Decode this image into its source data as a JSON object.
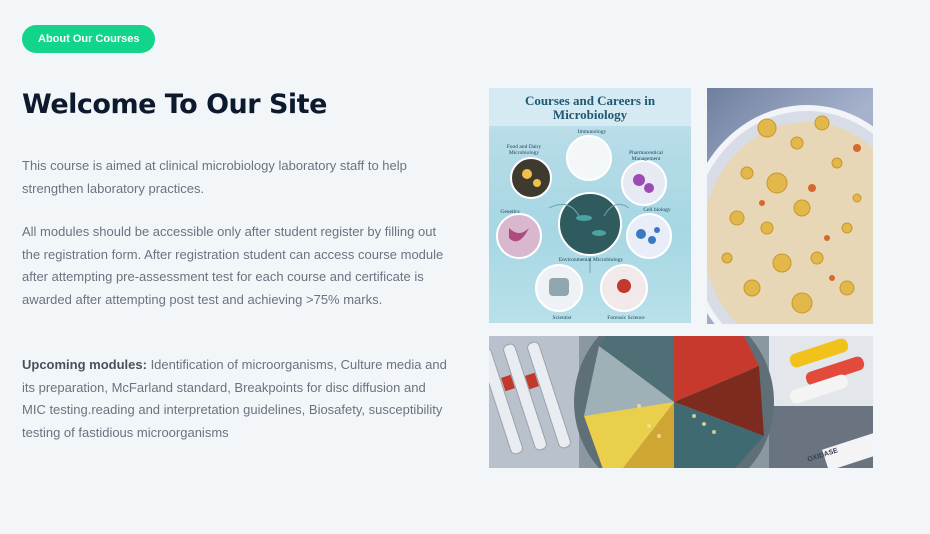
{
  "badge": {
    "label": "About Our Courses"
  },
  "page": {
    "title": "Welcome To Our Site"
  },
  "paragraphs": {
    "p1": "This course is aimed at clinical microbiology laboratory staff to help strengthen laboratory practices.",
    "p2": "All modules should be accessible only after student register by filling out the registration form. After registration student can access course module after attempting pre-assessment test for each course and certificate is awarded after attempting post test and achieving >75% marks.",
    "p3_label": "Upcoming modules:",
    "p3_text": " Identification of microorganisms, Culture media and its preparation, McFarland standard, Breakpoints for disc diffusion and MIC testing.reading and interpretation guidelines, Biosafety, susceptibility testing of fastidious microorganisms"
  },
  "images": {
    "poster": {
      "title_line1": "Courses and Careers in",
      "title_line2": "Microbiology",
      "captions": {
        "immunology": "Immunology",
        "food": "Food and Dairy Microbiology",
        "pharma": "Pharmaceutical Management",
        "genetics": "Genetics",
        "cell": "Cell biology",
        "environmental": "Environmental Microbiology",
        "scientist": "Scientist",
        "forensic": "Forensic Science"
      }
    },
    "collage": {
      "oxidase_label": "OXIDASE"
    }
  }
}
